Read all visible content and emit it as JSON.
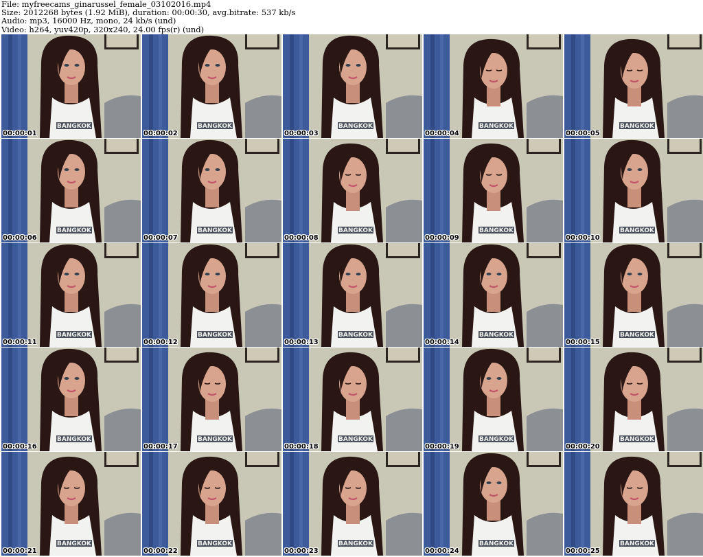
{
  "header": {
    "file_line": "File: myfreecams_ginarussel_female_03102016.mp4",
    "size_line": "Size: 2012268 bytes (1.92 MiB), duration: 00:00:30, avg.bitrate: 537 kb/s",
    "audio_line": "Audio: mp3, 16000 Hz, mono, 24 kb/s (und)",
    "video_line": "Video: h264, yuv420p, 320x240, 24.00 fps(r) (und)"
  },
  "colors": {
    "wall": "#c9c8b6",
    "curtain": "#3d5a9a",
    "sofa": "#8c8f94",
    "hair": "#2a1714",
    "skin": "#d9a48e",
    "shirt": "#f2f2f0",
    "print": "#2c3442"
  },
  "thumbnail_print_text": "BANGKOK",
  "thumbnails": [
    {
      "timestamp": "00:00:01",
      "head": "up"
    },
    {
      "timestamp": "00:00:02",
      "head": "up"
    },
    {
      "timestamp": "00:00:03",
      "head": "up"
    },
    {
      "timestamp": "00:00:04",
      "head": "down"
    },
    {
      "timestamp": "00:00:05",
      "head": "down"
    },
    {
      "timestamp": "00:00:06",
      "head": "up"
    },
    {
      "timestamp": "00:00:07",
      "head": "up"
    },
    {
      "timestamp": "00:00:08",
      "head": "down"
    },
    {
      "timestamp": "00:00:09",
      "head": "down"
    },
    {
      "timestamp": "00:00:10",
      "head": "up"
    },
    {
      "timestamp": "00:00:11",
      "head": "up"
    },
    {
      "timestamp": "00:00:12",
      "head": "up"
    },
    {
      "timestamp": "00:00:13",
      "head": "up"
    },
    {
      "timestamp": "00:00:14",
      "head": "up"
    },
    {
      "timestamp": "00:00:15",
      "head": "up"
    },
    {
      "timestamp": "00:00:16",
      "head": "up"
    },
    {
      "timestamp": "00:00:17",
      "head": "down"
    },
    {
      "timestamp": "00:00:18",
      "head": "down"
    },
    {
      "timestamp": "00:00:19",
      "head": "up"
    },
    {
      "timestamp": "00:00:20",
      "head": "down"
    },
    {
      "timestamp": "00:00:21",
      "head": "down"
    },
    {
      "timestamp": "00:00:22",
      "head": "down"
    },
    {
      "timestamp": "00:00:23",
      "head": "down"
    },
    {
      "timestamp": "00:00:24",
      "head": "up"
    },
    {
      "timestamp": "00:00:25",
      "head": "down"
    }
  ]
}
